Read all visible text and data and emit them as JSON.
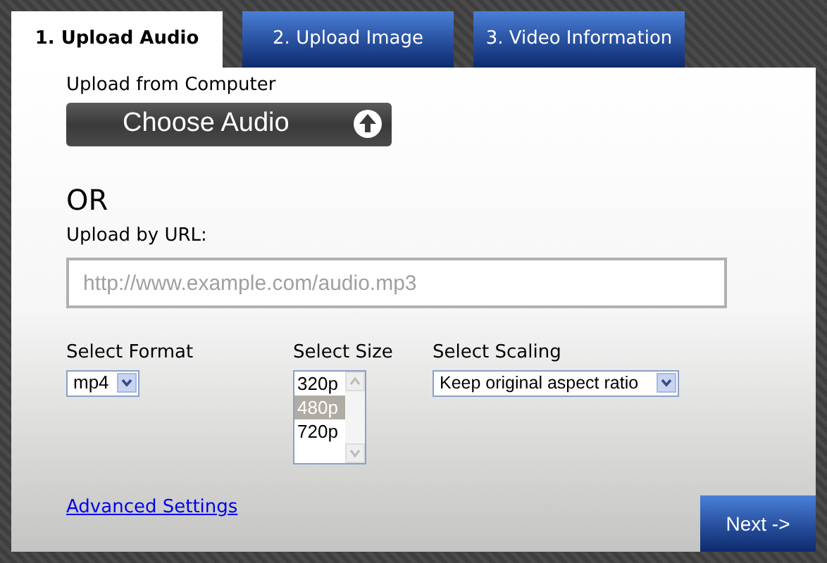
{
  "tabs": [
    {
      "label": "1. Upload Audio",
      "selected": true
    },
    {
      "label": "2. Upload Image",
      "selected": false
    },
    {
      "label": "3. Video Information",
      "selected": false
    }
  ],
  "upload_from_computer": {
    "label": "Upload from Computer",
    "button": "Choose Audio"
  },
  "separator": "OR",
  "url": {
    "label": "Upload by URL:",
    "placeholder": "http://www.example.com/audio.mp3"
  },
  "format": {
    "label": "Select Format",
    "value": "mp4"
  },
  "size": {
    "label": "Select Size",
    "options": [
      {
        "label": "320p",
        "selected": false
      },
      {
        "label": "480p",
        "selected": true
      },
      {
        "label": "720p",
        "selected": false
      }
    ]
  },
  "scaling": {
    "label": "Select Scaling",
    "value": "Keep original aspect ratio"
  },
  "advanced_link": "Advanced Settings",
  "next_button": "Next ->"
}
